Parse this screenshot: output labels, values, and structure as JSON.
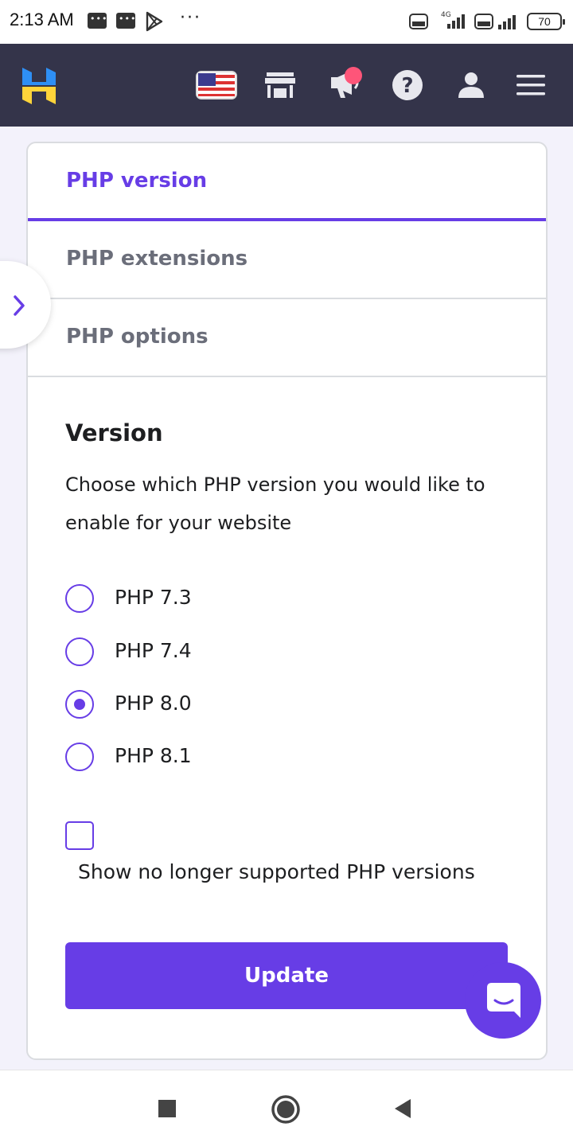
{
  "status_bar": {
    "time": "2:13 AM",
    "battery": "70",
    "icons": [
      "message-icon",
      "message-icon",
      "play-store-icon",
      "more-dots-icon",
      "volte-icon",
      "signal-4g-icon",
      "volte-icon",
      "signal-icon",
      "battery-icon"
    ]
  },
  "header": {
    "logo": "hostinger-logo",
    "icons": [
      "us-flag-icon",
      "store-icon",
      "announcement-icon",
      "help-icon",
      "user-icon",
      "menu-icon"
    ],
    "notification_dot_color": "#fe5579"
  },
  "tabs": [
    {
      "label": "PHP version",
      "active": true
    },
    {
      "label": "PHP extensions",
      "active": false
    },
    {
      "label": "PHP options",
      "active": false
    }
  ],
  "section": {
    "title": "Version",
    "description": "Choose which PHP version you would like to enable for your website"
  },
  "versions": [
    {
      "label": "PHP 7.3",
      "checked": false
    },
    {
      "label": "PHP 7.4",
      "checked": false
    },
    {
      "label": "PHP 8.0",
      "checked": true
    },
    {
      "label": "PHP 8.1",
      "checked": false
    }
  ],
  "show_unsupported": {
    "label": "Show no longer supported PHP versions",
    "checked": false
  },
  "update_button": "Update",
  "colors": {
    "accent": "#673de6",
    "header_bg": "#34344a",
    "page_bg": "#f3f2fb"
  },
  "nav_bar": [
    "recents-icon",
    "home-icon",
    "back-icon"
  ]
}
